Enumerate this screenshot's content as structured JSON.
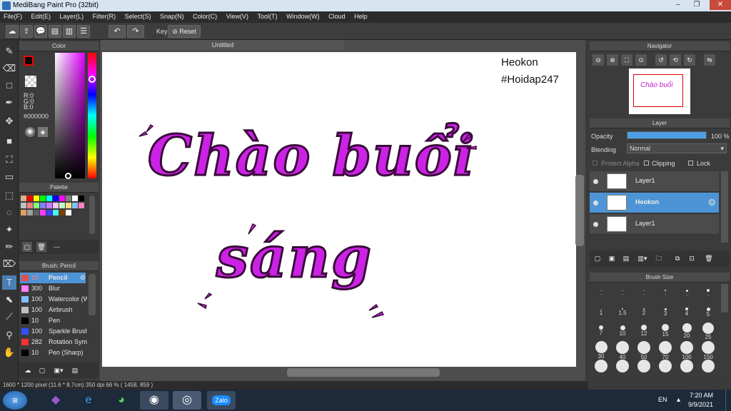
{
  "window": {
    "title": "MediBang Paint Pro (32bit)",
    "controls": [
      "–",
      "❐",
      "✕"
    ]
  },
  "menu": [
    "File(F)",
    "Edit(E)",
    "Layer(L)",
    "Filter(R)",
    "Select(S)",
    "Snap(N)",
    "Color(C)",
    "View(V)",
    "Tool(T)",
    "Window(W)",
    "Cloud",
    "Help"
  ],
  "toolbar": {
    "key_label": "Key",
    "reset_label": "Reset"
  },
  "color_panel": {
    "title": "Color",
    "r": "R:0",
    "g": "G:0",
    "b": "B:0",
    "hex": "#000000",
    "fg": "#000000",
    "bg": "#ffffff"
  },
  "palette_panel": {
    "title": "Palette",
    "footer_text": "---",
    "swatches": [
      "#d9b38c",
      "#ff0000",
      "#ffff00",
      "#00ff00",
      "#00ffff",
      "#0000ff",
      "#ff00ff",
      "#808080",
      "#ffffff",
      "#000000",
      "#c0c0c0",
      "#ff8080",
      "#80ff80",
      "#8080ff",
      "#c080ff",
      "#ffc0ff",
      "#c0ffc0",
      "#ffe080",
      "#80c0ff",
      "#ff80c0",
      "#e0a060",
      "#a0a0a0",
      "#606060",
      "#ff40ff",
      "#4040ff",
      "#40ffff",
      "#804000",
      "#ffffff"
    ]
  },
  "brush_panel": {
    "title": "Brush: Pencil",
    "items": [
      {
        "size": "15",
        "name": "Pencil",
        "color": "#e05050"
      },
      {
        "size": "300",
        "name": "Blur",
        "color": "#ff80ff"
      },
      {
        "size": "100",
        "name": "Watercolor (W",
        "color": "#80c0ff"
      },
      {
        "size": "100",
        "name": "Airbrush",
        "color": "#c0c0c0"
      },
      {
        "size": "10",
        "name": "Pen",
        "color": "#000000"
      },
      {
        "size": "100",
        "name": "Sparkle Brush",
        "color": "#3050ff"
      },
      {
        "size": "282",
        "name": "Rotation Sym",
        "color": "#ff3030"
      },
      {
        "size": "10",
        "name": "Pen (Sharp)",
        "color": "#000000"
      }
    ]
  },
  "document": {
    "tab_title": "Untitled",
    "watermark_line1": "Heokon",
    "watermark_line2": "#Hoidap247",
    "art_line1": "Chào buổi",
    "art_line2": "sáng"
  },
  "navigator": {
    "title": "Navigator"
  },
  "layer_panel": {
    "title": "Layer",
    "opacity_label": "Opacity",
    "opacity_value": "100 %",
    "opacity_percent": 100,
    "blending_label": "Blending",
    "blending_value": "Normal",
    "protect_alpha": "Protect Alpha",
    "clipping": "Clipping",
    "lock": "Lock",
    "layers": [
      {
        "name": "Layer1",
        "selected": false
      },
      {
        "name": "Heokon",
        "selected": true
      },
      {
        "name": "Layer1",
        "selected": false
      }
    ]
  },
  "brush_size_panel": {
    "title": "Brush Size",
    "sizes": [
      "·",
      "·",
      "·",
      "·",
      "·",
      "·",
      "1",
      "1.5",
      "2",
      "3",
      "4",
      "5",
      "7",
      "10",
      "12",
      "15",
      "20",
      "25",
      "30",
      "40",
      "50",
      "70",
      "100",
      "150",
      "",
      "",
      "",
      "",
      "",
      ""
    ]
  },
  "status": {
    "text": "1600 * 1200 pixel   (11.6 * 8.7cm)   350 dpi   66 %   ( 1458, 859 )"
  },
  "taskbar": {
    "time": "7:20 AM",
    "date": "9/9/2021",
    "lang": "EN",
    "zalo_label": "Zalo"
  }
}
